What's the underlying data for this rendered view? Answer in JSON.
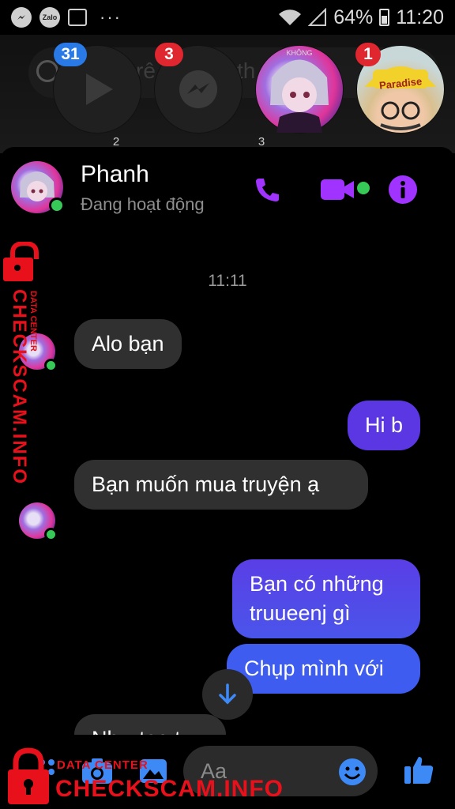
{
  "status_bar": {
    "left_icons": [
      "messenger-icon",
      "zalo-icon",
      "gallery-icon"
    ],
    "zalo_label": "Zalo",
    "more": "···",
    "battery": "64%",
    "time": "11:20"
  },
  "chat_heads": {
    "search_ghost_1": "rê",
    "search_ghost_2": "th",
    "heads": [
      {
        "badge": "31",
        "icon": "play-icon",
        "small_count": "2"
      },
      {
        "badge": "3",
        "icon": "messenger-icon",
        "small_count": "3"
      },
      {
        "badge": "",
        "icon": "avatar",
        "label": "KHÔNG"
      },
      {
        "badge": "1",
        "icon": "avatar-yellow-cap",
        "cap_text": "Paradise"
      }
    ]
  },
  "chat": {
    "contact_name": "Phanh",
    "status": "Đang hoạt động",
    "header_icons": [
      "phone-icon",
      "video-call-icon",
      "info-icon"
    ],
    "timestamp": "11:11",
    "messages": [
      {
        "from": "them",
        "text": "Alo bạn"
      },
      {
        "from": "me",
        "text": "Hi b"
      },
      {
        "from": "them",
        "text": "Bạn muốn mua truyện ạ"
      },
      {
        "from": "me",
        "text": "Bạn có những truueenj gì"
      },
      {
        "from": "me",
        "text": "Chụp mình với"
      },
      {
        "from": "them",
        "text": "Như tạo t"
      }
    ]
  },
  "composer": {
    "placeholder": "Aa",
    "icons": [
      "menu-dots-icon",
      "camera-icon",
      "gallery-icon",
      "emoji-icon",
      "like-icon"
    ]
  },
  "watermark": {
    "vertical_text": "CHECKSCAM.INFO",
    "vertical_small": "DATA CENTER",
    "bottom_small": "DATA CENTER",
    "bottom_text": "CHECKSCAM.INFO"
  },
  "colors": {
    "accent": "#a033ff",
    "outgoing_bubble": "#5b37e3",
    "incoming_bubble": "#303030",
    "online": "#36c957",
    "badge_red": "#e0262e",
    "badge_blue": "#2979e6",
    "watermark": "#e8101a"
  }
}
